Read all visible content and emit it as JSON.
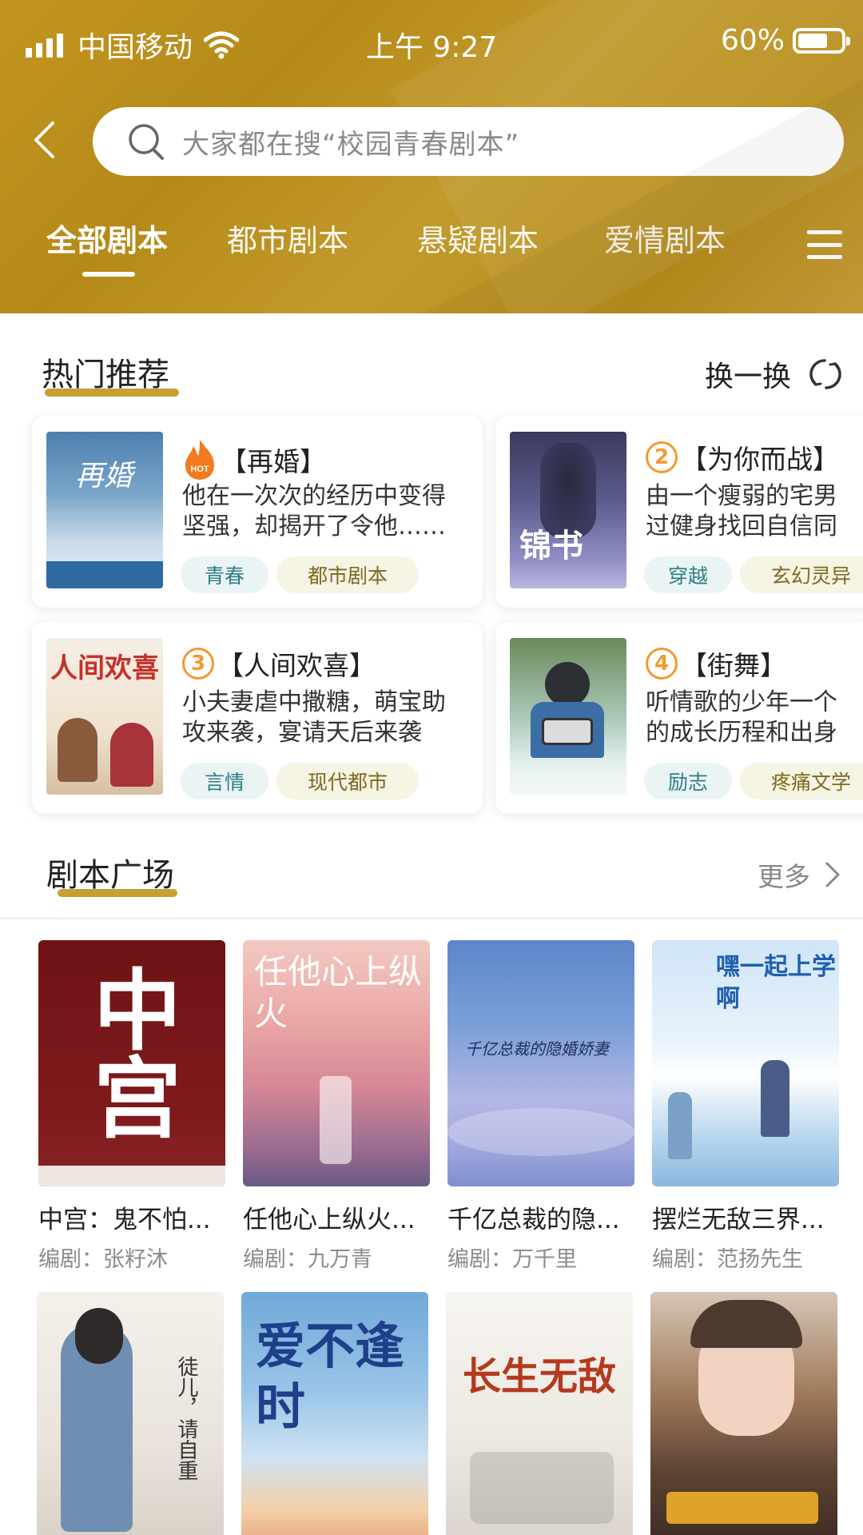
{
  "status_bar": {
    "carrier": "中国移动",
    "time": "上午 9:27",
    "battery": "60%"
  },
  "search": {
    "placeholder": "大家都在搜“校园青春剧本”"
  },
  "tabs": [
    {
      "label": "全部剧本",
      "active": true
    },
    {
      "label": "都市剧本",
      "active": false
    },
    {
      "label": "悬疑剧本",
      "active": false
    },
    {
      "label": "爱情剧本",
      "active": false
    }
  ],
  "hot": {
    "title": "热门推荐",
    "refresh_label": "换一换",
    "items": [
      {
        "rank": "HOT",
        "title": "【再婚】",
        "desc": "他在一次次的经历中变得\n坚强，却揭开了令他……",
        "tags": [
          "青春",
          "都市剧本"
        ],
        "cover_text": "再婚"
      },
      {
        "rank": "2",
        "title": "【为你而战】",
        "desc": "由一个瘦弱的宅男⁠\n过健身找回自信同",
        "tags": [
          "穿越",
          "玄幻灵异"
        ],
        "cover_text": "锦书"
      },
      {
        "rank": "3",
        "title": "【人间欢喜】",
        "desc": "小夫妻虐中撒糖，萌宝助\n攻来袭，宴请天后来袭",
        "tags": [
          "言情",
          "现代都市"
        ],
        "cover_text": "人间欢喜"
      },
      {
        "rank": "4",
        "title": "【街舞】",
        "desc": "听情歌的少年一个\n的成长历程和出身",
        "tags": [
          "励志",
          "疼痛文学"
        ],
        "cover_text": ""
      }
    ]
  },
  "plaza": {
    "title": "剧本广场",
    "more_label": "更多",
    "books": [
      {
        "title": "中宫：鬼不怕...",
        "author": "编剧：张籽沐",
        "cover_text": "中宫"
      },
      {
        "title": "任他心上纵火...",
        "author": "编剧：九万青",
        "cover_text": "任他心上纵火"
      },
      {
        "title": "千亿总裁的隐...",
        "author": "编剧：万千里",
        "cover_text": "千亿总裁的隐婚娇妻"
      },
      {
        "title": "摆烂无敌三界...",
        "author": "编剧：范扬先生",
        "cover_text": "嘿一起上学啊"
      },
      {
        "title": "",
        "author": "",
        "cover_text": "徒儿，请自重"
      },
      {
        "title": "",
        "author": "",
        "cover_text": "爱不逢时"
      },
      {
        "title": "",
        "author": "",
        "cover_text": "长生无敌"
      },
      {
        "title": "",
        "author": "",
        "cover_text": ""
      }
    ]
  }
}
